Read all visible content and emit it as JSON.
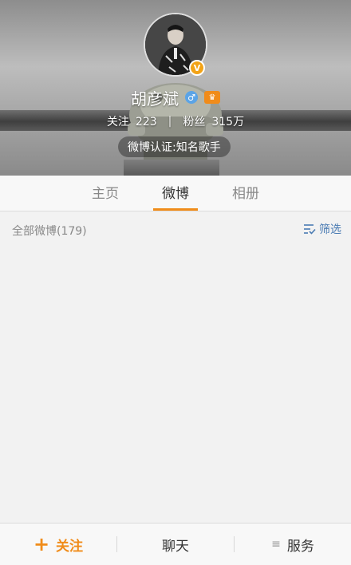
{
  "profile": {
    "name": "胡彦斌",
    "gender_icon": "male-icon",
    "member_icon": "vip-member-icon",
    "verified_badge": "V",
    "stats": {
      "following_label": "关注",
      "following_count": "223",
      "followers_label": "粉丝",
      "followers_count": "315万"
    },
    "verification": "微博认证:知名歌手"
  },
  "tabs": [
    {
      "label": "主页",
      "active": false
    },
    {
      "label": "微博",
      "active": true
    },
    {
      "label": "相册",
      "active": false
    }
  ],
  "feed": {
    "all_count_label": "全部微博(179)",
    "filter_label": "筛选"
  },
  "bottom_bar": {
    "follow_label": "关注",
    "chat_label": "聊天",
    "service_label": "服务"
  },
  "colors": {
    "accent": "#f08c1a",
    "link": "#4a7bb3",
    "verified": "#f3a316"
  }
}
